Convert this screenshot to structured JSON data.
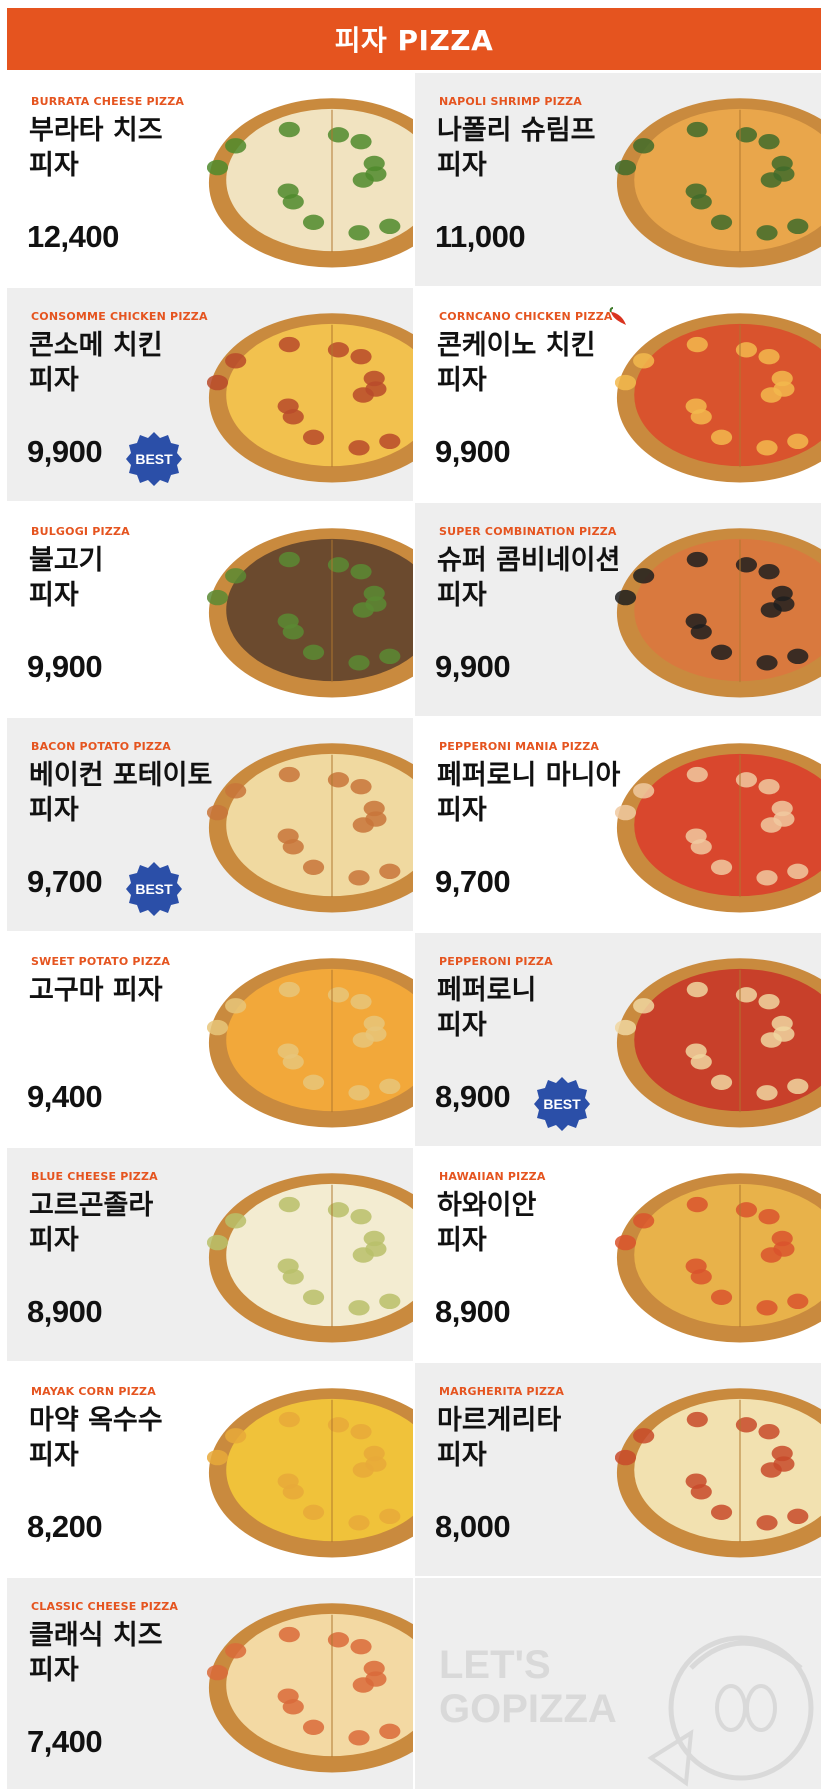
{
  "header": {
    "title": "피자 PIZZA"
  },
  "badge_label": "BEST",
  "menu": [
    {
      "eng": "BURRATA CHEESE PIZZA",
      "kor": "부라타 치즈\n피자",
      "price": "12,400",
      "best": false
    },
    {
      "eng": "NAPOLI SHRIMP PIZZA",
      "kor": "나폴리 슈림프\n피자",
      "price": "11,000",
      "best": false
    },
    {
      "eng": "CONSOMME CHICKEN PIZZA",
      "kor": "콘소메 치킨\n피자",
      "price": "9,900",
      "best": true
    },
    {
      "eng": "CORNCANO CHICKEN PIZZA",
      "kor": "콘케이노 치킨\n피자",
      "price": "9,900",
      "best": false,
      "spicy": true
    },
    {
      "eng": "BULGOGI PIZZA",
      "kor": "불고기\n피자",
      "price": "9,900",
      "best": false
    },
    {
      "eng": "SUPER COMBINATION PIZZA",
      "kor": "슈퍼 콤비네이션\n피자",
      "price": "9,900",
      "best": false
    },
    {
      "eng": "BACON POTATO PIZZA",
      "kor": "베이컨 포테이토\n피자",
      "price": "9,700",
      "best": true
    },
    {
      "eng": "PEPPERONI MANIA PIZZA",
      "kor": "페퍼로니 마니아\n피자",
      "price": "9,700",
      "best": false
    },
    {
      "eng": "SWEET POTATO PIZZA",
      "kor": "고구마 피자",
      "price": "9,400",
      "best": false
    },
    {
      "eng": "PEPPERONI PIZZA",
      "kor": "페퍼로니\n피자",
      "price": "8,900",
      "best": true
    },
    {
      "eng": "BLUE CHEESE PIZZA",
      "kor": "고르곤졸라\n피자",
      "price": "8,900",
      "best": false
    },
    {
      "eng": "HAWAIIAN PIZZA",
      "kor": "하와이안\n피자",
      "price": "8,900",
      "best": false
    },
    {
      "eng": "MAYAK CORN PIZZA",
      "kor": "마약 옥수수\n피자",
      "price": "8,200",
      "best": false
    },
    {
      "eng": "MARGHERITA PIZZA",
      "kor": "마르게리타\n피자",
      "price": "8,000",
      "best": false
    },
    {
      "eng": "CLASSIC CHEESE PIZZA",
      "kor": "클래식 치즈\n피자",
      "price": "7,400",
      "best": false
    }
  ],
  "brand": {
    "slogan": "LET'S\nGOPIZZA"
  },
  "colors": {
    "accent": "#e5541f",
    "badge": "#2b4fa8",
    "card_gray": "#eeeeee",
    "logo_gray": "#d9d9d9"
  },
  "icons": {
    "badge": "best-badge-icon",
    "spicy": "chili-pepper-icon",
    "mascot": "gopizza-mascot-icon"
  }
}
